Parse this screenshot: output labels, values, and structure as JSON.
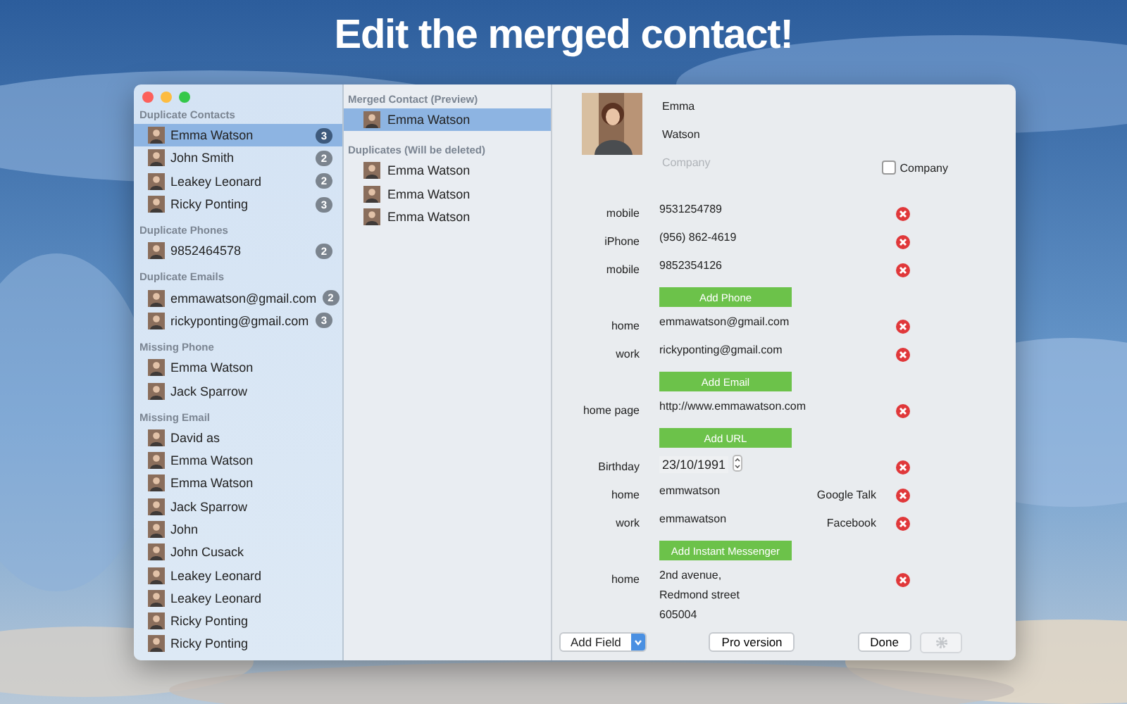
{
  "headline": "Edit the merged contact!",
  "sidebar": {
    "sections": [
      {
        "title": "Duplicate Contacts",
        "items": [
          {
            "name": "Emma Watson",
            "count": "3",
            "selected": true
          },
          {
            "name": "John Smith",
            "count": "2",
            "selected": false
          },
          {
            "name": "Leakey Leonard",
            "count": "2",
            "selected": false
          },
          {
            "name": "Ricky Ponting",
            "count": "3",
            "selected": false
          }
        ]
      },
      {
        "title": "Duplicate Phones",
        "items": [
          {
            "name": "9852464578",
            "count": "2",
            "selected": false
          }
        ]
      },
      {
        "title": "Duplicate Emails",
        "items": [
          {
            "name": "emmawatson@gmail.com",
            "count": "2",
            "selected": false
          },
          {
            "name": "rickyponting@gmail.com",
            "count": "3",
            "selected": false
          }
        ]
      },
      {
        "title": "Missing Phone",
        "items": [
          {
            "name": "Emma Watson",
            "selected": false
          },
          {
            "name": "Jack Sparrow",
            "selected": false
          }
        ]
      },
      {
        "title": "Missing Email",
        "items": [
          {
            "name": "David as",
            "selected": false
          },
          {
            "name": "Emma Watson",
            "selected": false
          },
          {
            "name": "Emma Watson",
            "selected": false
          },
          {
            "name": "Jack Sparrow",
            "selected": false
          },
          {
            "name": "John",
            "selected": false
          },
          {
            "name": "John Cusack",
            "selected": false
          },
          {
            "name": "Leakey Leonard",
            "selected": false
          },
          {
            "name": "Leakey Leonard",
            "selected": false
          },
          {
            "name": "Ricky Ponting",
            "selected": false
          },
          {
            "name": "Ricky Ponting",
            "selected": false
          }
        ]
      }
    ]
  },
  "merge": {
    "sections": [
      {
        "title": "Merged Contact (Preview)",
        "items": [
          {
            "name": "Emma Watson",
            "selected": true
          }
        ]
      },
      {
        "title": "Duplicates (Will be deleted)",
        "items": [
          {
            "name": "Emma Watson",
            "selected": false
          },
          {
            "name": "Emma Watson",
            "selected": false
          },
          {
            "name": "Emma Watson",
            "selected": false
          }
        ]
      }
    ]
  },
  "detail": {
    "first_name": "Emma",
    "last_name": "Watson",
    "company": {
      "placeholder": "Company"
    },
    "company_checkbox": {
      "label": "Company",
      "checked": false
    },
    "fields": [
      {
        "kind": "field",
        "label": "mobile",
        "value": "9531254789"
      },
      {
        "kind": "field",
        "label": "iPhone",
        "value": "(956) 862-4619"
      },
      {
        "kind": "field",
        "label": "mobile",
        "value": "9852354126"
      },
      {
        "kind": "add",
        "label": "Add Phone"
      },
      {
        "kind": "field",
        "label": "home",
        "value": "emmawatson@gmail.com"
      },
      {
        "kind": "field",
        "label": "work",
        "value": "rickyponting@gmail.com"
      },
      {
        "kind": "add",
        "label": "Add Email"
      },
      {
        "kind": "field",
        "label": "home page",
        "value": "http://www.emmawatson.com"
      },
      {
        "kind": "add",
        "label": "Add URL"
      },
      {
        "kind": "date",
        "label": "Birthday",
        "value": "23/10/1991"
      },
      {
        "kind": "field",
        "label": "home",
        "value": "emmwatson",
        "service": "Google Talk"
      },
      {
        "kind": "field",
        "label": "work",
        "value": "emmawatson",
        "service": "Facebook"
      },
      {
        "kind": "add",
        "label": "Add Instant Messenger"
      },
      {
        "kind": "address",
        "label": "home",
        "lines": [
          "2nd avenue,",
          "Redmond street",
          "605004"
        ]
      }
    ]
  },
  "footer": {
    "add_field": "Add Field",
    "pro": "Pro version",
    "done": "Done"
  }
}
